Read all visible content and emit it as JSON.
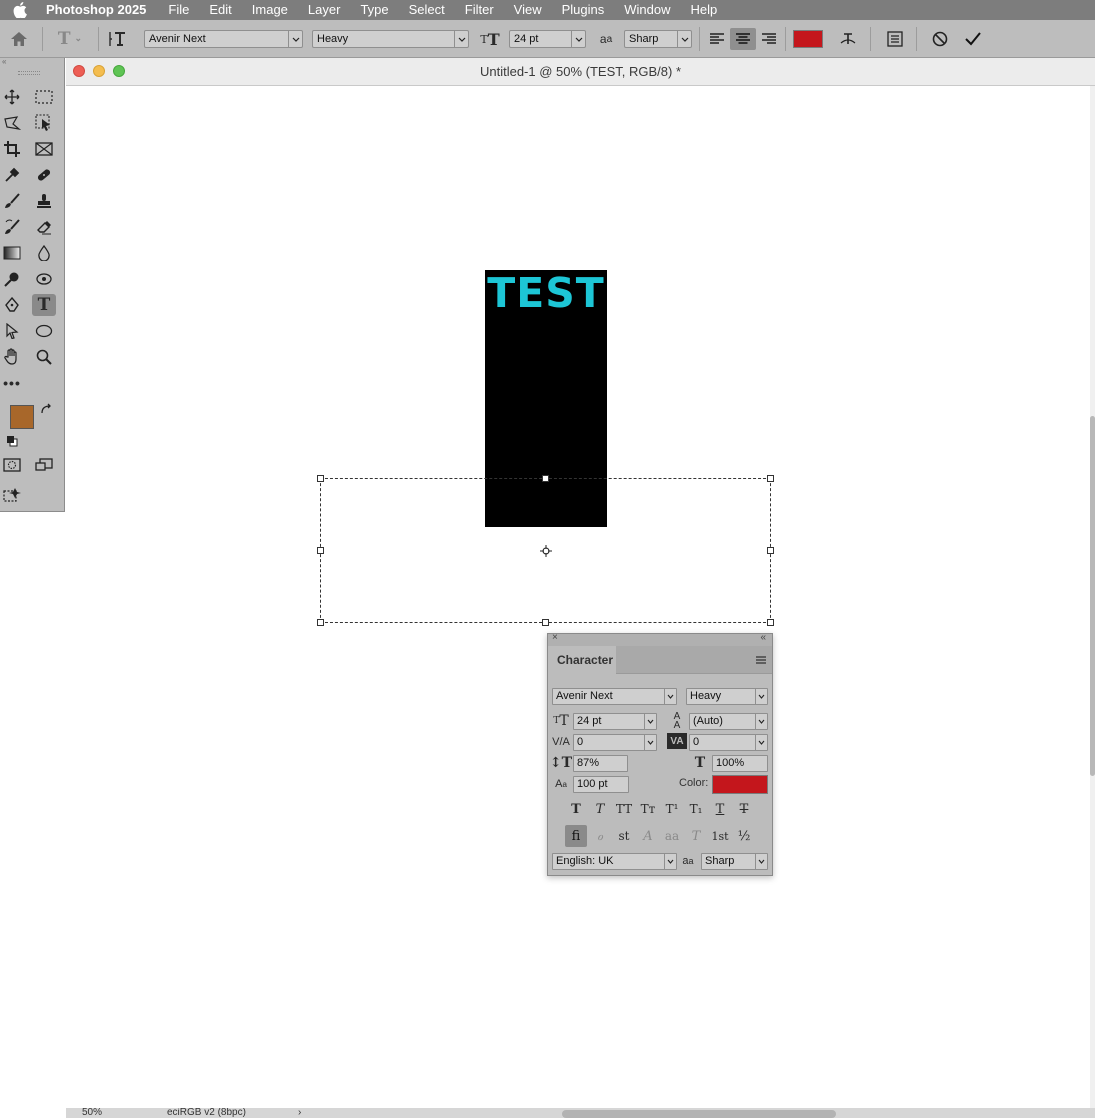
{
  "menubar": {
    "app_name": "Photoshop 2025",
    "items": [
      "File",
      "Edit",
      "Image",
      "Layer",
      "Type",
      "Select",
      "Filter",
      "View",
      "Plugins",
      "Window",
      "Help"
    ]
  },
  "options_bar": {
    "font_family": "Avenir Next",
    "font_style": "Heavy",
    "font_size": "24 pt",
    "antialias": "Sharp",
    "text_color": "#c4161c"
  },
  "toolbar": {
    "foreground_color": "#a8672a",
    "background_color": "#ffffff"
  },
  "document": {
    "title": "Untitled-1 @ 50% (TEST, RGB/8) *",
    "canvas_text": "TEST",
    "canvas_text_color": "#1dc6d6",
    "zoom": "50%",
    "color_profile": "eciRGB v2 (8bpc)"
  },
  "character_panel": {
    "tab": "Character",
    "font_family": "Avenir Next",
    "font_style": "Heavy",
    "font_size": "24 pt",
    "leading": "(Auto)",
    "kerning": "0",
    "tracking": "0",
    "vertical_scale": "87%",
    "horizontal_scale": "100%",
    "baseline_shift": "100 pt",
    "color_label": "Color:",
    "color": "#c4161c",
    "language": "English: UK",
    "antialias": "Sharp",
    "style_buttons": [
      "T",
      "T",
      "TT",
      "Tт",
      "T¹",
      "T₁",
      "T",
      "T"
    ],
    "opentype_buttons": [
      "ﬁ",
      "ℴ",
      "st",
      "A",
      "aa",
      "T",
      "1st",
      "½"
    ]
  }
}
